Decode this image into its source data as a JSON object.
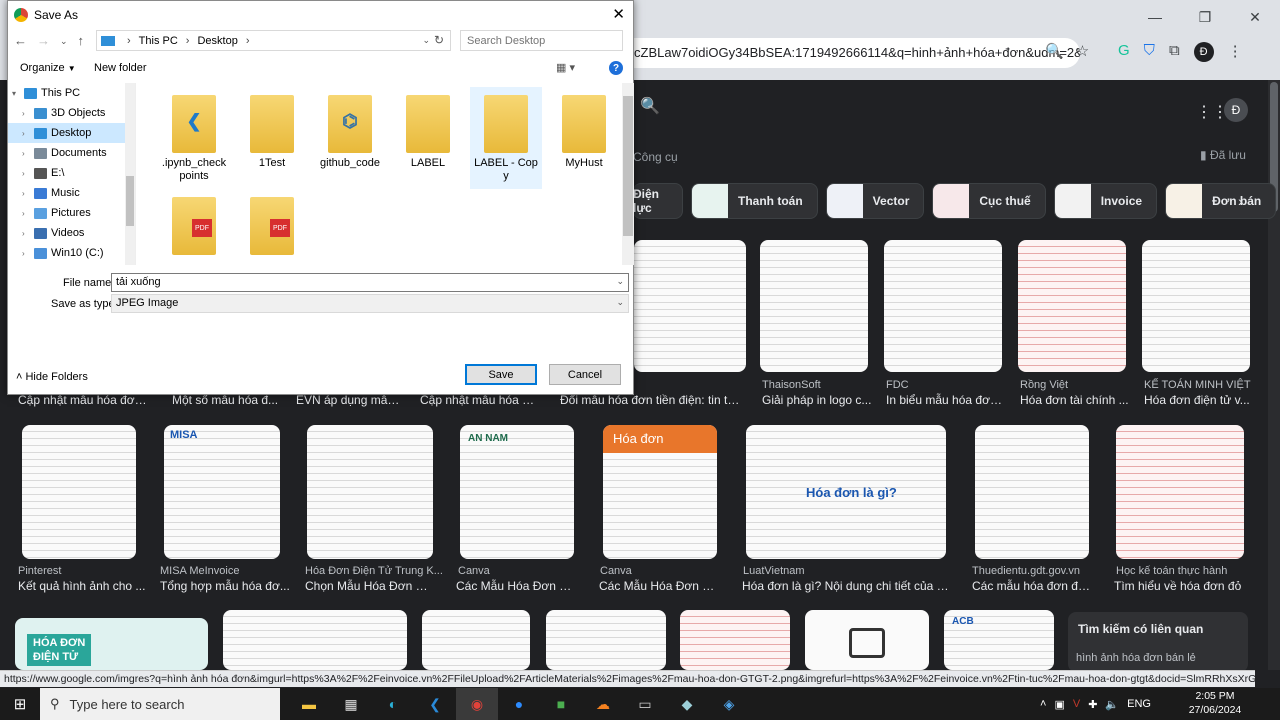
{
  "browser": {
    "address_text": "cZBLaw7oidiOGy34BbSEA:1719492666114&q=hinh+ảnh+hóa+đơn&udm=2&...",
    "profile_initial": "Đ"
  },
  "google": {
    "tools_label": "Công cụ",
    "saved_label": "Đã lưu",
    "avatar_initial": "Đ",
    "chips": [
      "Điện lực",
      "Thanh toán",
      "Vector",
      "Cục thuế",
      "Invoice",
      "Đơn bán"
    ],
    "row1": [
      {
        "source": "",
        "title": "Cập nhật mẫu hóa đơn ..."
      },
      {
        "source": "",
        "title": "Một số mẫu hóa đ..."
      },
      {
        "source": "",
        "title": "EVN áp dụng mẫu ..."
      },
      {
        "source": "",
        "title": "Cập nhật mẫu hóa đơn..."
      },
      {
        "source": "",
        "title": "Đổi mẫu hóa đơn tiền điện: tin tức, ..."
      },
      {
        "source": "ThaisonSoft",
        "title": "Giải pháp in logo c..."
      },
      {
        "source": "FDC",
        "title": "In biểu mẫu hóa đơn..."
      },
      {
        "source": "Rồng Việt",
        "title": "Hóa đơn tài chính ..."
      },
      {
        "source": "KẾ TOÁN MINH VIỆT",
        "title": "Hóa đơn điện tử v..."
      }
    ],
    "row2": [
      {
        "source": "Pinterest",
        "title": "Kết quả hình ảnh cho ..."
      },
      {
        "source": "MISA MeInvoice",
        "title": "Tổng hợp mẫu hóa đơ..."
      },
      {
        "source": "Hóa Đơn Điện Tử Trung K...",
        "title": "Chọn Mẫu Hóa Đơn Điệ..."
      },
      {
        "source": "Canva",
        "title": "Các Mẫu Hóa Đơn Ch..."
      },
      {
        "source": "Canva",
        "title": "Các Mẫu Hóa Đơn Ch..."
      },
      {
        "source": "LuatVietnam",
        "title": "Hóa đơn là gì? Nội dung chi tiết của hóa ..."
      },
      {
        "source": "Thuedientu.gdt.gov.vn",
        "title": "Các mẫu hóa đơn điện..."
      },
      {
        "source": "Học kế toán thực hành",
        "title": "Tìm hiểu về hóa đơn đỏ"
      }
    ],
    "thumb_text_hoadon": "Hóa đơn",
    "thumb_text_hoadon_la_gi": "Hóa đơn là gì?",
    "thumb_text_an_nam": "AN NAM",
    "thumb_text_misa": "MISA",
    "thumb_text_hoa_don_dien_tu": "HÓA ĐƠN\nĐIỆN TỬ",
    "thumb_text_acb": "ACB",
    "related_title": "Tìm kiếm có liên quan",
    "related_sub": "hình ảnh hóa đơn bán lẻ"
  },
  "status_url": "https://www.google.com/imgres?q=hình ảnh hóa đơn&imgurl=https%3A%2F%2Feinvoice.vn%2FFileUpload%2FArticleMaterials%2Fimages%2Fmau-hoa-don-GTGT-2.png&imgrefurl=https%3A%2F%2Feinvoice.vn%2Ftin-tuc%2Fmau-hoa-don-gtgt&docid=SlmRRhXsXrGTkM&tbnid=...",
  "dialog": {
    "title": "Save As",
    "path": [
      "This PC",
      "Desktop"
    ],
    "search_placeholder": "Search Desktop",
    "organize_label": "Organize",
    "new_folder_label": "New folder",
    "tree": [
      {
        "label": "This PC",
        "level": 0,
        "color": "#2f8fd8"
      },
      {
        "label": "3D Objects",
        "level": 1,
        "color": "#3a8fd0"
      },
      {
        "label": "Desktop",
        "level": 1,
        "color": "#2f8fd8",
        "selected": true
      },
      {
        "label": "Documents",
        "level": 1,
        "color": "#7a8a99"
      },
      {
        "label": "E:\\",
        "level": 1,
        "color": "#555"
      },
      {
        "label": "Music",
        "level": 1,
        "color": "#3a7bd5"
      },
      {
        "label": "Pictures",
        "level": 1,
        "color": "#5aa0e0"
      },
      {
        "label": "Videos",
        "level": 1,
        "color": "#3a6fb0"
      },
      {
        "label": "Win10 (C:)",
        "level": 1,
        "color": "#4a90d9"
      }
    ],
    "files": [
      {
        "name": ".ipynb_checkpoints",
        "badge": "vscode"
      },
      {
        "name": "1Test",
        "badge": ""
      },
      {
        "name": "github_code",
        "badge": "python"
      },
      {
        "name": "LABEL",
        "badge": ""
      },
      {
        "name": "LABEL - Copy",
        "badge": "",
        "hover": true
      },
      {
        "name": "MyHust",
        "badge": ""
      },
      {
        "name": "",
        "badge": "pdf"
      },
      {
        "name": "",
        "badge": "pdf"
      }
    ],
    "filename_label": "File name:",
    "filename_value": "tải xuống",
    "type_label": "Save as type:",
    "type_value": "JPEG Image",
    "hide_folders_label": "Hide Folders",
    "save_label": "Save",
    "cancel_label": "Cancel"
  },
  "taskbar": {
    "search_hint": "Type here to search",
    "lang": "ENG",
    "time": "2:05 PM",
    "date": "27/06/2024"
  }
}
